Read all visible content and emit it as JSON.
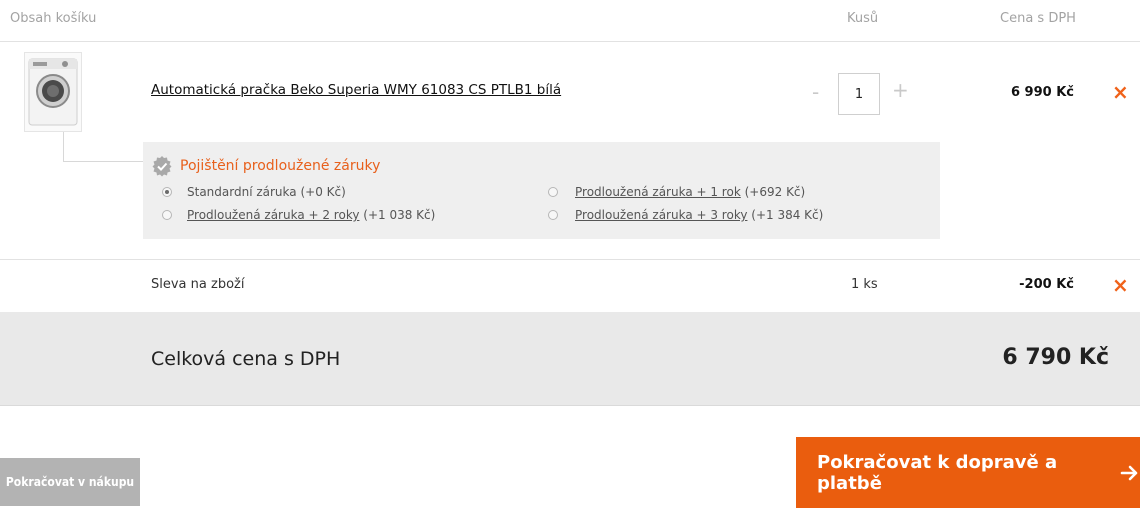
{
  "header": {
    "contents_label": "Obsah košíku",
    "quantity_label": "Kusů",
    "price_label": "Cena s DPH"
  },
  "product": {
    "name": "Automatická pračka Beko Superia WMY 61083 CS PTLB1 bílá",
    "quantity": "1",
    "price": "6 990 Kč",
    "minus": "-",
    "plus": "+",
    "remove_icon": "×"
  },
  "warranty": {
    "title": "Pojištění prodloužené záruky",
    "options": [
      {
        "label": "Standardní záruka",
        "extra": "(+0 Kč)",
        "selected": true,
        "link": false
      },
      {
        "label": "Prodloužená záruka + 1 rok",
        "extra": "(+692 Kč)",
        "selected": false,
        "link": true
      },
      {
        "label": "Prodloužená záruka + 2 roky",
        "extra": "(+1 038 Kč)",
        "selected": false,
        "link": true
      },
      {
        "label": "Prodloužená záruka + 3 roky",
        "extra": "(+1 384 Kč)",
        "selected": false,
        "link": true
      }
    ]
  },
  "discount": {
    "label": "Sleva na zboží",
    "quantity": "1 ks",
    "price": "-200 Kč",
    "remove_icon": "×"
  },
  "total": {
    "label": "Celková cena s DPH",
    "price": "6 790 Kč"
  },
  "actions": {
    "back_label": "Pokračovat v nákupu",
    "next_label": "Pokračovat k dopravě a platbě",
    "next_icon": "arrow-right-icon"
  },
  "colors": {
    "accent": "#ea5d0e",
    "back_button": "#b3b3b3",
    "warranty_bg": "#efefef",
    "total_bg": "#e9e9e9"
  }
}
